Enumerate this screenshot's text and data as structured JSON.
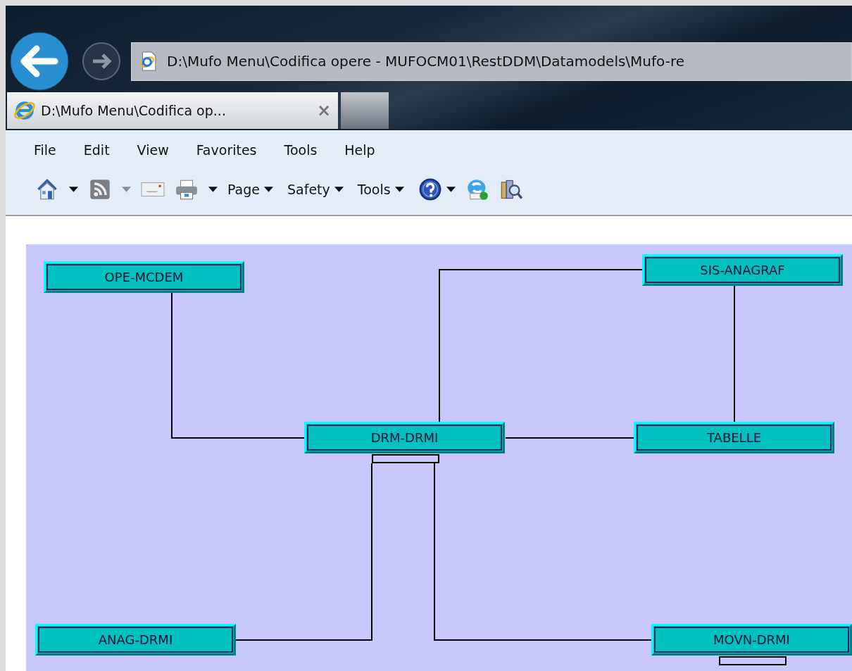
{
  "address_bar": {
    "value": "D:\\Mufo Menu\\Codifica opere - MUFOCM01\\RestDDM\\Datamodels\\Mufo-re"
  },
  "tabs": [
    {
      "label": "D:\\Mufo Menu\\Codifica op...",
      "close": "×",
      "selected": true
    }
  ],
  "menu": [
    "File",
    "Edit",
    "View",
    "Favorites",
    "Tools",
    "Help"
  ],
  "toolbar": [
    {
      "kind": "home"
    },
    {
      "kind": "caret",
      "disabled": false
    },
    {
      "kind": "feeds"
    },
    {
      "kind": "caret",
      "disabled": true
    },
    {
      "kind": "mail"
    },
    {
      "kind": "print"
    },
    {
      "kind": "caret",
      "disabled": false
    },
    {
      "kind": "menu",
      "label": "Page"
    },
    {
      "kind": "menu",
      "label": "Safety"
    },
    {
      "kind": "menu",
      "label": "Tools"
    },
    {
      "kind": "help"
    },
    {
      "kind": "messenger"
    },
    {
      "kind": "research"
    }
  ],
  "diagram": {
    "nodes": [
      {
        "label": "OPE-MCDEM",
        "stub": false
      },
      {
        "label": "SIS-ANAGRAF",
        "stub": false
      },
      {
        "label": "DRM-DRMI",
        "stub": true
      },
      {
        "label": "TABELLE",
        "stub": false
      },
      {
        "label": "ANAG-DRMI",
        "stub": false
      },
      {
        "label": "MOVN-DRMI",
        "stub": true
      }
    ]
  }
}
